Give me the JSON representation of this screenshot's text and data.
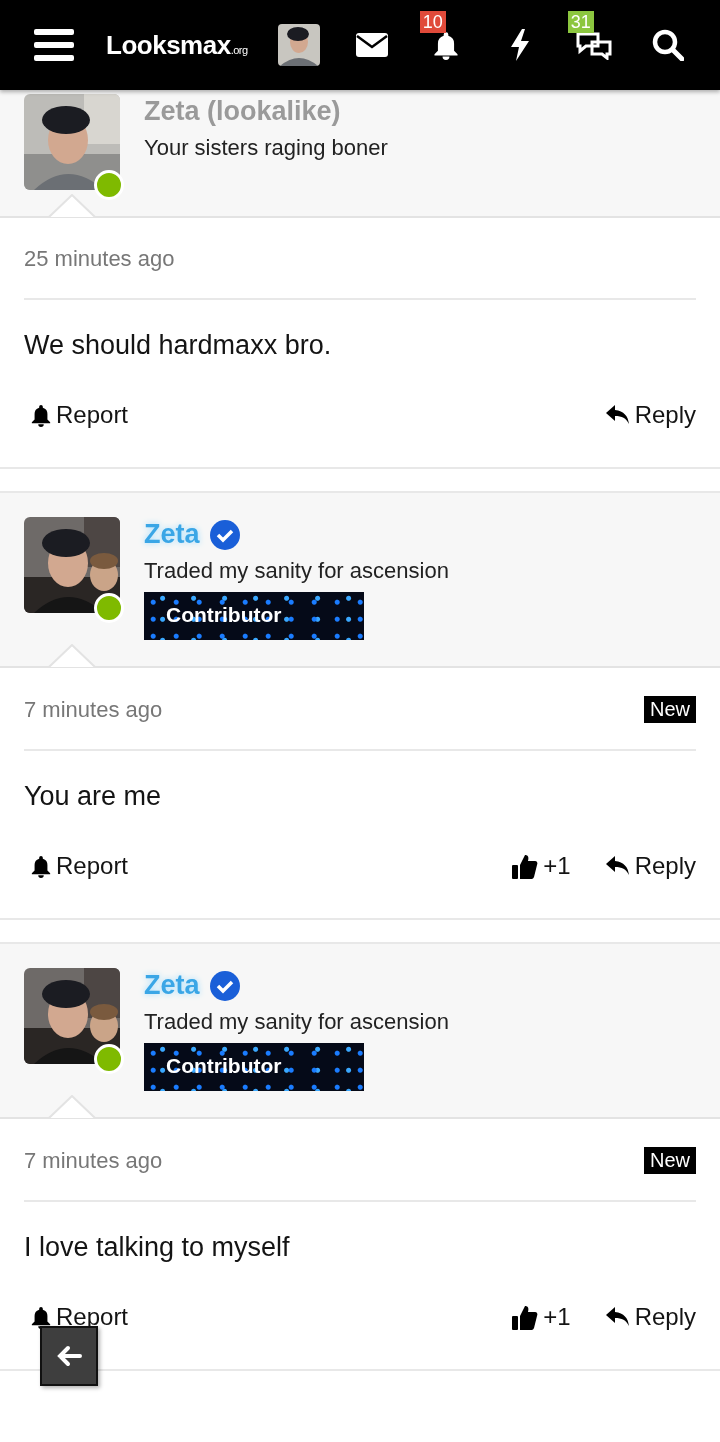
{
  "header": {
    "logo": "Looksmax",
    "logo_suffix": ".org",
    "alerts_count": "10",
    "conversations_count": "31"
  },
  "posts": [
    {
      "author": {
        "name": "Zeta (lookalike)",
        "highlighted": false,
        "online": true,
        "title": "Your sisters raging boner"
      },
      "time": "25 minutes ago",
      "message": "We should hardmaxx bro.",
      "actions": {
        "report": "Report",
        "reply": "Reply"
      },
      "cut_top": true
    },
    {
      "author": {
        "name": "Zeta",
        "highlighted": true,
        "verified": true,
        "online": true,
        "title": "Traded my sanity for ascension",
        "banner": "Contributor"
      },
      "time": "7 minutes ago",
      "new_label": "New",
      "message": "You are me",
      "actions": {
        "report": "Report",
        "likes": "+1",
        "reply": "Reply"
      }
    },
    {
      "author": {
        "name": "Zeta",
        "highlighted": true,
        "verified": true,
        "online": true,
        "title": "Traded my sanity for ascension",
        "banner": "Contributor"
      },
      "time": "7 minutes ago",
      "new_label": "New",
      "message": "I love talking to myself",
      "actions": {
        "report": "Report",
        "likes": "+1",
        "reply": "Reply"
      }
    }
  ]
}
